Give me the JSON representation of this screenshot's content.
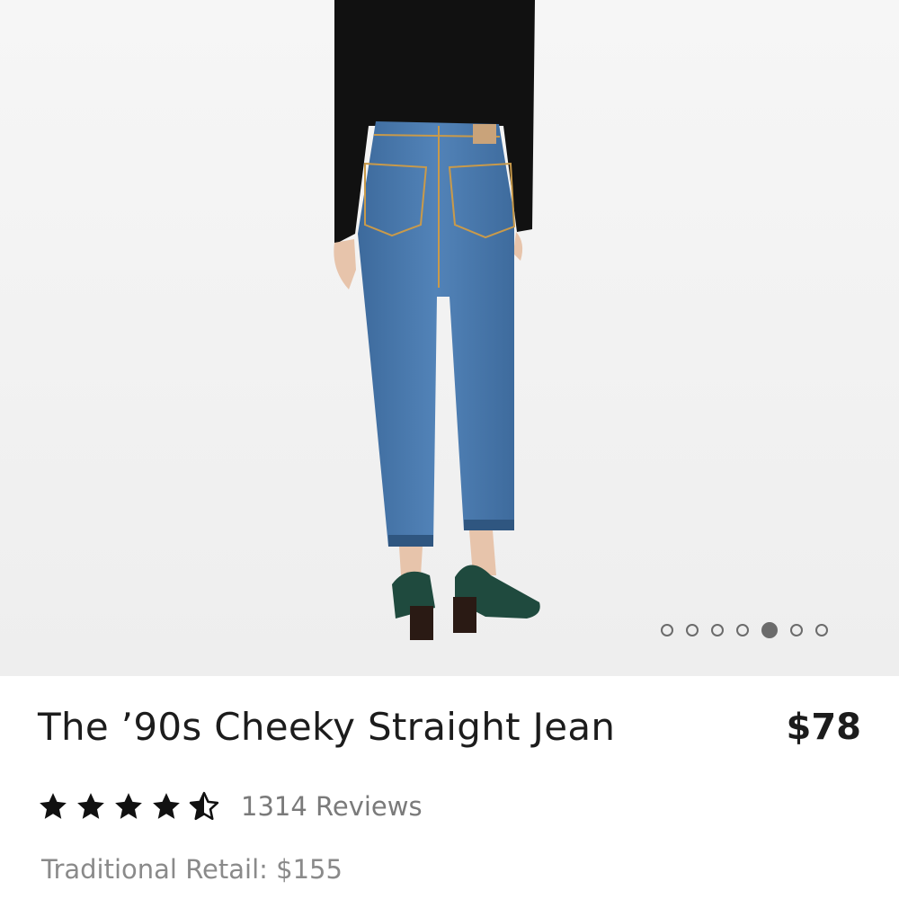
{
  "product": {
    "title": "The ’90s Cheeky Straight Jean",
    "price": "$78",
    "rating": 4.5,
    "rating_max": 5,
    "reviews_label": "1314 Reviews",
    "retail_label": "Traditional Retail:",
    "retail_value": "$155"
  },
  "carousel": {
    "total": 7,
    "active_index": 4
  },
  "colors": {
    "denim": "#4a76a8",
    "top": "#111111",
    "shoe": "#1f4a3e",
    "text": "#1c1c1c",
    "muted": "#7a7a7a"
  },
  "icons": {
    "rating": "star-icon",
    "carousel": "carousel-dot-icon"
  }
}
